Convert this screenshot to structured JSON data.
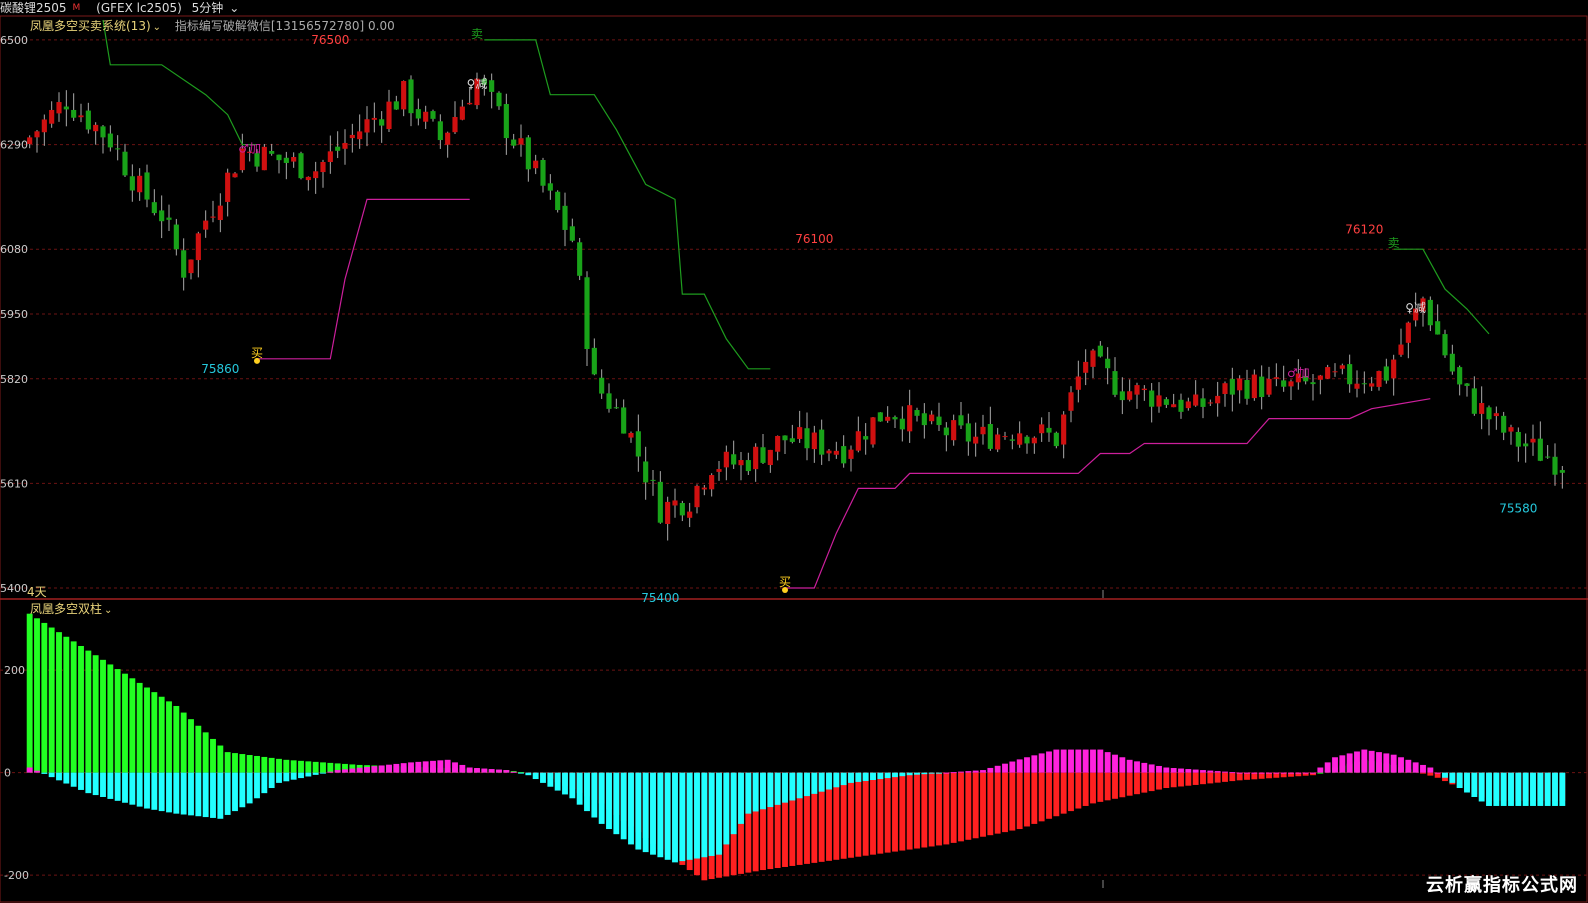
{
  "header": {
    "symbol": "碳酸锂2505",
    "symbol_mark": "M",
    "exchange": "(GFEX lc2505)",
    "period": "5分钟",
    "period_chevron": "⌄"
  },
  "main_indicator": {
    "name": "凤凰多空买卖系统(13)",
    "chevron": "⌄",
    "note": "指标编写破解微信[13156572780] 0.00"
  },
  "sub_indicator": {
    "name": "凤凰多空双柱",
    "chevron": "⌄"
  },
  "days_label": "4天",
  "watermark": "云析赢指标公式网",
  "colors": {
    "up_candle": "#d01010",
    "down_candle": "#19a319",
    "wick": "#aaaaaa",
    "sell_line": "#1e9c1e",
    "buy_line": "#cc1f9c",
    "grid": "#6b1313",
    "axis_text": "#cccccc",
    "high_label": "#ff4040",
    "low_label": "#25c8dc",
    "bar_green": "#22ff22",
    "bar_magenta": "#ff22dd",
    "bar_cyan": "#22ffff",
    "bar_red": "#ff2020"
  },
  "chart_data": [
    {
      "type": "candlestick",
      "ylim": [
        75380,
        76540
      ],
      "y_ticks": [
        76500,
        76290,
        76080,
        75950,
        75820,
        75610,
        75400
      ],
      "y_tick_labels": [
        "6500",
        "6290",
        "6080",
        "5950",
        "5820",
        "5610",
        "5400"
      ],
      "price_anchors": [
        [
          0,
          76290
        ],
        [
          6,
          76380
        ],
        [
          12,
          76300
        ],
        [
          16,
          76200
        ],
        [
          19,
          76150
        ],
        [
          22,
          76040
        ],
        [
          25,
          76140
        ],
        [
          30,
          76280
        ],
        [
          40,
          76240
        ],
        [
          46,
          76320
        ],
        [
          52,
          76390
        ],
        [
          57,
          76300
        ],
        [
          62,
          76420
        ],
        [
          70,
          76230
        ],
        [
          75,
          76100
        ],
        [
          78,
          75810
        ],
        [
          82,
          75740
        ],
        [
          87,
          75560
        ],
        [
          91,
          75580
        ],
        [
          94,
          75650
        ],
        [
          98,
          75650
        ],
        [
          104,
          75700
        ],
        [
          112,
          75680
        ],
        [
          118,
          75760
        ],
        [
          124,
          75720
        ],
        [
          130,
          75700
        ],
        [
          136,
          75720
        ],
        [
          141,
          75700
        ],
        [
          145,
          75860
        ],
        [
          150,
          75800
        ],
        [
          156,
          75780
        ],
        [
          160,
          75760
        ],
        [
          166,
          75810
        ],
        [
          172,
          75800
        ],
        [
          180,
          75820
        ],
        [
          186,
          75830
        ],
        [
          191,
          75980
        ],
        [
          196,
          75800
        ],
        [
          203,
          75700
        ],
        [
          210,
          75650
        ]
      ],
      "annotations_high": [
        {
          "label": "76500",
          "x": 41,
          "y": 76500
        },
        {
          "label": "76100",
          "x": 107,
          "y": 76100
        },
        {
          "label": "76120",
          "x": 182,
          "y": 76120
        }
      ],
      "annotations_low": [
        {
          "label": "75860",
          "x": 26,
          "y": 75860
        },
        {
          "label": "75400",
          "x": 86,
          "y": 75400
        },
        {
          "label": "75580",
          "x": 203,
          "y": 75580
        }
      ],
      "signals": [
        {
          "label": "卖",
          "x": 61,
          "y": 76500,
          "color": "#1e9c1e"
        },
        {
          "label": "♀减",
          "x": 61,
          "y": 76400,
          "color": "#dddddd"
        },
        {
          "label": "♂加",
          "x": 30,
          "y": 76270,
          "color": "#cc1f9c"
        },
        {
          "label": "买",
          "x": 31,
          "y": 75860,
          "color": "#ffd020"
        },
        {
          "label": "买",
          "x": 103,
          "y": 75400,
          "color": "#ffd020"
        },
        {
          "label": "♂加",
          "x": 173,
          "y": 75820,
          "color": "#cc1f9c"
        },
        {
          "label": "卖",
          "x": 186,
          "y": 76080,
          "color": "#1e9c1e"
        },
        {
          "label": "♀减",
          "x": 189,
          "y": 75950,
          "color": "#dddddd"
        }
      ],
      "sell_line": [
        [
          10,
          76540
        ],
        [
          11,
          76450
        ],
        [
          18,
          76450
        ],
        [
          24,
          76390
        ],
        [
          27,
          76350
        ],
        [
          29,
          76290
        ],
        [
          31,
          76290
        ]
      ],
      "sell_line2": [
        [
          62,
          76500
        ],
        [
          69,
          76500
        ],
        [
          71,
          76390
        ],
        [
          77,
          76390
        ],
        [
          80,
          76320
        ],
        [
          84,
          76210
        ],
        [
          88,
          76180
        ],
        [
          89,
          75990
        ],
        [
          92,
          75990
        ],
        [
          95,
          75900
        ],
        [
          98,
          75840
        ],
        [
          101,
          75840
        ]
      ],
      "sell_line3": [
        [
          186,
          76080
        ],
        [
          190,
          76080
        ],
        [
          193,
          76000
        ],
        [
          196,
          75960
        ],
        [
          199,
          75910
        ]
      ],
      "buy_line": [
        [
          31,
          75860
        ],
        [
          41,
          75860
        ],
        [
          43,
          76020
        ],
        [
          46,
          76180
        ],
        [
          60,
          76180
        ]
      ],
      "buy_line2": [
        [
          103,
          75400
        ],
        [
          107,
          75400
        ],
        [
          110,
          75510
        ],
        [
          113,
          75600
        ],
        [
          118,
          75600
        ],
        [
          120,
          75630
        ],
        [
          143,
          75630
        ],
        [
          146,
          75670
        ],
        [
          150,
          75670
        ],
        [
          152,
          75690
        ],
        [
          166,
          75690
        ],
        [
          169,
          75740
        ],
        [
          180,
          75740
        ],
        [
          183,
          75760
        ],
        [
          191,
          75780
        ]
      ]
    },
    {
      "type": "bar",
      "ylim": [
        -225,
        325
      ],
      "y_ticks": [
        200,
        0,
        -200
      ],
      "y_tick_labels": [
        "200",
        "0",
        "-200"
      ],
      "series": [],
      "slow_anchors": [
        [
          0,
          310
        ],
        [
          10,
          220
        ],
        [
          20,
          130
        ],
        [
          27,
          40
        ],
        [
          35,
          25
        ],
        [
          45,
          15
        ],
        [
          55,
          10
        ],
        [
          65,
          5
        ],
        [
          70,
          -5
        ],
        [
          78,
          -60
        ],
        [
          86,
          -150
        ],
        [
          92,
          -210
        ],
        [
          100,
          -190
        ],
        [
          105,
          -180
        ],
        [
          115,
          -160
        ],
        [
          125,
          -140
        ],
        [
          135,
          -110
        ],
        [
          145,
          -60
        ],
        [
          155,
          -30
        ],
        [
          165,
          -15
        ],
        [
          175,
          -5
        ],
        [
          178,
          10
        ],
        [
          182,
          25
        ],
        [
          186,
          15
        ],
        [
          192,
          -10
        ],
        [
          199,
          -55
        ]
      ],
      "fast_anchors": [
        [
          0,
          10
        ],
        [
          8,
          -40
        ],
        [
          16,
          -70
        ],
        [
          20,
          -80
        ],
        [
          26,
          -90
        ],
        [
          30,
          -60
        ],
        [
          34,
          -20
        ],
        [
          42,
          5
        ],
        [
          52,
          20
        ],
        [
          57,
          25
        ],
        [
          60,
          10
        ],
        [
          65,
          5
        ],
        [
          68,
          -5
        ],
        [
          74,
          -50
        ],
        [
          78,
          -100
        ],
        [
          83,
          -150
        ],
        [
          88,
          -175
        ],
        [
          94,
          -160
        ],
        [
          98,
          -80
        ],
        [
          105,
          -50
        ],
        [
          112,
          -20
        ],
        [
          120,
          -5
        ],
        [
          130,
          5
        ],
        [
          136,
          30
        ],
        [
          140,
          45
        ],
        [
          146,
          45
        ],
        [
          150,
          25
        ],
        [
          155,
          10
        ],
        [
          165,
          0
        ],
        [
          175,
          0
        ],
        [
          178,
          30
        ],
        [
          182,
          45
        ],
        [
          186,
          35
        ],
        [
          191,
          10
        ],
        [
          195,
          -30
        ],
        [
          199,
          -65
        ]
      ]
    }
  ]
}
